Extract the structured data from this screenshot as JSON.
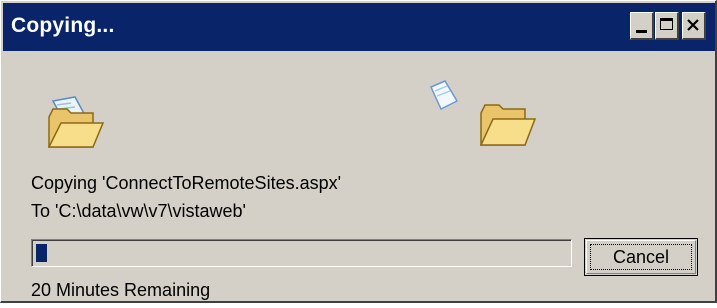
{
  "window": {
    "title": "Copying...",
    "title_bg": "#0a246a",
    "face_color": "#d4d0c8",
    "controls": [
      {
        "name": "minimize",
        "icon": "minimize-icon"
      },
      {
        "name": "maximize",
        "icon": "maximize-icon"
      },
      {
        "name": "close",
        "icon": "close-icon"
      }
    ]
  },
  "animation": {
    "source_icon": "open-folder-icon",
    "moving_icon": "paper-document-icon",
    "destination_icon": "open-folder-icon"
  },
  "status": {
    "copying_line": "Copying 'ConnectToRemoteSites.aspx'",
    "to_line": "To 'C:\\data\\vw\\v7\\vistaweb'",
    "time_remaining": "20 Minutes Remaining"
  },
  "progress": {
    "percent": 2,
    "fill_color": "#0a246a"
  },
  "buttons": {
    "cancel_label": "Cancel"
  }
}
